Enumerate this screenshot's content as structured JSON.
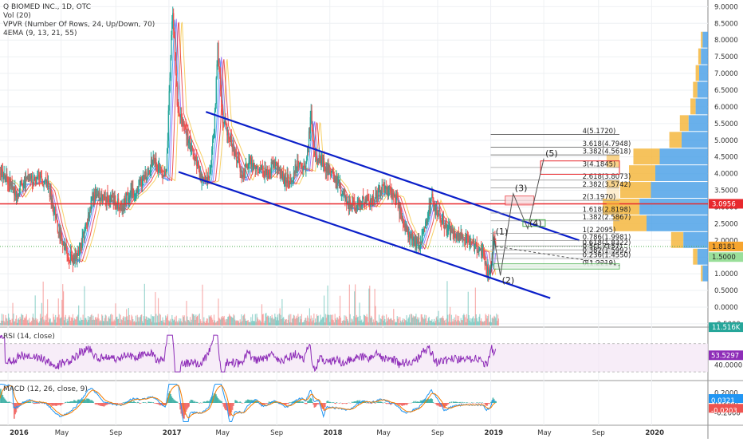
{
  "header": {
    "symbol_line": "Q BIOMED INC., 1D, OTC",
    "vol_line": "Vol (20)",
    "vpvr_line": "VPVR (Number Of Rows, 24, Up/Down, 70)",
    "ema_line": "4EMA (9, 13, 21, 55)"
  },
  "rsi_label": "RSI (14, close)",
  "macd_label": "MACD (12, 26, close, 9)",
  "colors": {
    "channel": "#0b1fc9",
    "resistance": "#e8282d",
    "up": "#26a69a",
    "down": "#ef5350",
    "rsi_line": "#8e2db8",
    "macd_line": "#2196f3",
    "signal_line": "#f57c00",
    "vpvr_up": "#4fa3e8",
    "vpvr_down": "#f5b840"
  },
  "chart_data": [
    {
      "type": "candlestick",
      "panel": "price",
      "y_ticks": [
        "9.0000",
        "8.5000",
        "8.0000",
        "7.5000",
        "7.0000",
        "6.5000",
        "6.0000",
        "5.5000",
        "5.0000",
        "4.5000",
        "4.0000",
        "3.5000",
        "3.0000",
        "2.5000",
        "2.0000",
        "1.5000",
        "1.0000",
        "0.5000",
        "0.0000",
        "-0.5000"
      ],
      "y_tick_values": [
        9.0,
        8.5,
        8.0,
        7.5,
        7.0,
        6.5,
        6.0,
        5.5,
        5.0,
        4.5,
        4.0,
        3.5,
        3.0,
        2.5,
        2.0,
        1.5,
        1.0,
        0.5,
        0.0,
        -0.5
      ],
      "ylim": [
        -0.55,
        9.2
      ],
      "x_ticks": [
        "2016",
        "May",
        "Sep",
        "2017",
        "May",
        "Sep",
        "2018",
        "May",
        "Sep",
        "2019",
        "May",
        "Sep",
        "2020"
      ],
      "x_tick_values": [
        2016.0,
        2016.33,
        2016.67,
        2017.0,
        2017.33,
        2017.67,
        2018.0,
        2018.33,
        2018.67,
        2019.0,
        2019.33,
        2019.67,
        2020.0
      ],
      "xlim": [
        2015.95,
        2020.35
      ],
      "price_path": [
        [
          2015.95,
          4.0
        ],
        [
          2016.0,
          3.8
        ],
        [
          2016.05,
          3.4
        ],
        [
          2016.1,
          3.8
        ],
        [
          2016.15,
          3.8
        ],
        [
          2016.2,
          3.9
        ],
        [
          2016.25,
          3.6
        ],
        [
          2016.3,
          2.5
        ],
        [
          2016.33,
          2.0
        ],
        [
          2016.38,
          1.5
        ],
        [
          2016.42,
          1.4
        ],
        [
          2016.47,
          2.2
        ],
        [
          2016.52,
          3.3
        ],
        [
          2016.56,
          3.3
        ],
        [
          2016.6,
          3.3
        ],
        [
          2016.65,
          3.2
        ],
        [
          2016.7,
          3.0
        ],
        [
          2016.75,
          3.4
        ],
        [
          2016.8,
          3.6
        ],
        [
          2016.85,
          3.9
        ],
        [
          2016.9,
          4.4
        ],
        [
          2016.95,
          4.0
        ],
        [
          2016.98,
          3.9
        ],
        [
          2017.0,
          6.5
        ],
        [
          2017.02,
          9.0
        ],
        [
          2017.05,
          6.0
        ],
        [
          2017.1,
          5.2
        ],
        [
          2017.15,
          4.6
        ],
        [
          2017.2,
          3.8
        ],
        [
          2017.25,
          3.9
        ],
        [
          2017.28,
          5.5
        ],
        [
          2017.3,
          7.8
        ],
        [
          2017.33,
          5.6
        ],
        [
          2017.38,
          5.0
        ],
        [
          2017.42,
          4.5
        ],
        [
          2017.46,
          3.9
        ],
        [
          2017.5,
          4.4
        ],
        [
          2017.55,
          4.2
        ],
        [
          2017.6,
          4.0
        ],
        [
          2017.65,
          4.3
        ],
        [
          2017.7,
          3.9
        ],
        [
          2017.75,
          3.8
        ],
        [
          2017.8,
          4.3
        ],
        [
          2017.85,
          4.2
        ],
        [
          2017.88,
          5.8
        ],
        [
          2017.9,
          4.5
        ],
        [
          2017.95,
          4.4
        ],
        [
          2018.0,
          4.0
        ],
        [
          2018.05,
          3.7
        ],
        [
          2018.1,
          3.1
        ],
        [
          2018.15,
          3.0
        ],
        [
          2018.2,
          3.2
        ],
        [
          2018.25,
          3.1
        ],
        [
          2018.3,
          3.5
        ],
        [
          2018.35,
          3.5
        ],
        [
          2018.4,
          3.4
        ],
        [
          2018.45,
          2.6
        ],
        [
          2018.5,
          2.1
        ],
        [
          2018.55,
          1.8
        ],
        [
          2018.6,
          2.6
        ],
        [
          2018.63,
          3.3
        ],
        [
          2018.67,
          2.8
        ],
        [
          2018.72,
          2.4
        ],
        [
          2018.78,
          2.2
        ],
        [
          2018.85,
          2.0
        ],
        [
          2018.9,
          1.8
        ],
        [
          2018.95,
          1.7
        ],
        [
          2018.97,
          1.0
        ],
        [
          2019.0,
          1.3
        ],
        [
          2019.01,
          2.05
        ],
        [
          2019.03,
          1.82
        ]
      ],
      "channel_upper": [
        [
          2017.23,
          5.85
        ],
        [
          2019.55,
          2.0
        ]
      ],
      "channel_lower": [
        [
          2017.06,
          4.05
        ],
        [
          2019.37,
          0.27
        ]
      ],
      "resistance_level": 3.0956,
      "price_badges": [
        {
          "text": "3.0956",
          "value": 3.0956,
          "bg": "#e8282d",
          "fg": "#ffffff"
        },
        {
          "text": "1.8181",
          "value": 1.8181,
          "bg": "#f7a52f",
          "fg": "#222222"
        },
        {
          "text": "1.5000",
          "value": 1.5,
          "bg": "#9adf9a",
          "fg": "#222222"
        },
        {
          "text": "11.516K",
          "value": -0.6,
          "bg": "#26a69a",
          "fg": "#ffffff"
        }
      ],
      "fib_levels": [
        {
          "label": "4(5.1720)",
          "value": 5.172
        },
        {
          "label": "3.618(4.7948)",
          "value": 4.7948
        },
        {
          "label": "3.382(4.5618)",
          "value": 4.5618
        },
        {
          "label": "3(4.1845)",
          "value": 4.1845
        },
        {
          "label": "2.618(3.8073)",
          "value": 3.8073
        },
        {
          "label": "2.382(3.5742)",
          "value": 3.5742
        },
        {
          "label": "2(3.1970)",
          "value": 3.197
        },
        {
          "label": "1.618(2.8198)",
          "value": 2.8198
        },
        {
          "label": "1.382(2.5867)",
          "value": 2.5867
        },
        {
          "label": "1(2.2095)",
          "value": 2.2095
        },
        {
          "label": "0.786(1.9981)",
          "value": 1.9981
        },
        {
          "label": "0.618(1.8322)",
          "value": 1.8322
        },
        {
          "label": "0.5(1.7157)",
          "value": 1.7157
        },
        {
          "label": "0.382(1.5992)",
          "value": 1.5992
        },
        {
          "label": "0.236(1.4550)",
          "value": 1.455
        },
        {
          "label": "0(1.2219)",
          "value": 1.2219
        }
      ],
      "waves": [
        {
          "label": "(1)",
          "x": 2019.02,
          "y": 2.1
        },
        {
          "label": "(2)",
          "x": 2019.06,
          "y": 0.95
        },
        {
          "label": "(3)",
          "x": 2019.14,
          "y": 3.4
        },
        {
          "label": "(4)",
          "x": 2019.23,
          "y": 2.35
        },
        {
          "label": "(5)",
          "x": 2019.33,
          "y": 4.45
        }
      ],
      "vpvr": [
        {
          "value": 8.0,
          "up": 6,
          "down": 2
        },
        {
          "value": 7.5,
          "up": 8,
          "down": 3
        },
        {
          "value": 7.0,
          "up": 10,
          "down": 4
        },
        {
          "value": 6.5,
          "up": 12,
          "down": 5
        },
        {
          "value": 6.0,
          "up": 14,
          "down": 6
        },
        {
          "value": 5.5,
          "up": 22,
          "down": 10
        },
        {
          "value": 5.0,
          "up": 30,
          "down": 14
        },
        {
          "value": 4.5,
          "up": 55,
          "down": 30
        },
        {
          "value": 4.0,
          "up": 60,
          "down": 30
        },
        {
          "value": 3.5,
          "up": 65,
          "down": 35
        },
        {
          "value": 3.0,
          "up": 78,
          "down": 42
        },
        {
          "value": 2.5,
          "up": 70,
          "down": 38
        },
        {
          "value": 2.0,
          "up": 28,
          "down": 14
        },
        {
          "value": 1.5,
          "up": 12,
          "down": 5
        },
        {
          "value": 1.0,
          "up": 6,
          "down": 2
        }
      ]
    },
    {
      "type": "line",
      "panel": "rsi",
      "name": "RSI (14, close)",
      "current_value": "53.5297",
      "y_ticks": [
        "40.0000"
      ],
      "ylim": [
        20,
        90
      ],
      "bands": [
        70,
        30
      ]
    },
    {
      "type": "line",
      "panel": "macd",
      "name": "MACD (12, 26, close, 9)",
      "y_ticks": [
        "0.2000",
        "0.0000",
        "-0.2000"
      ],
      "value_badges": [
        {
          "text": "0.0321",
          "value": 0.0321,
          "bg": "#2196f3"
        },
        {
          "text": "-0.0203",
          "value": -0.0203,
          "bg": "#ef5350"
        }
      ],
      "ylim": [
        -0.42,
        0.42
      ]
    }
  ]
}
